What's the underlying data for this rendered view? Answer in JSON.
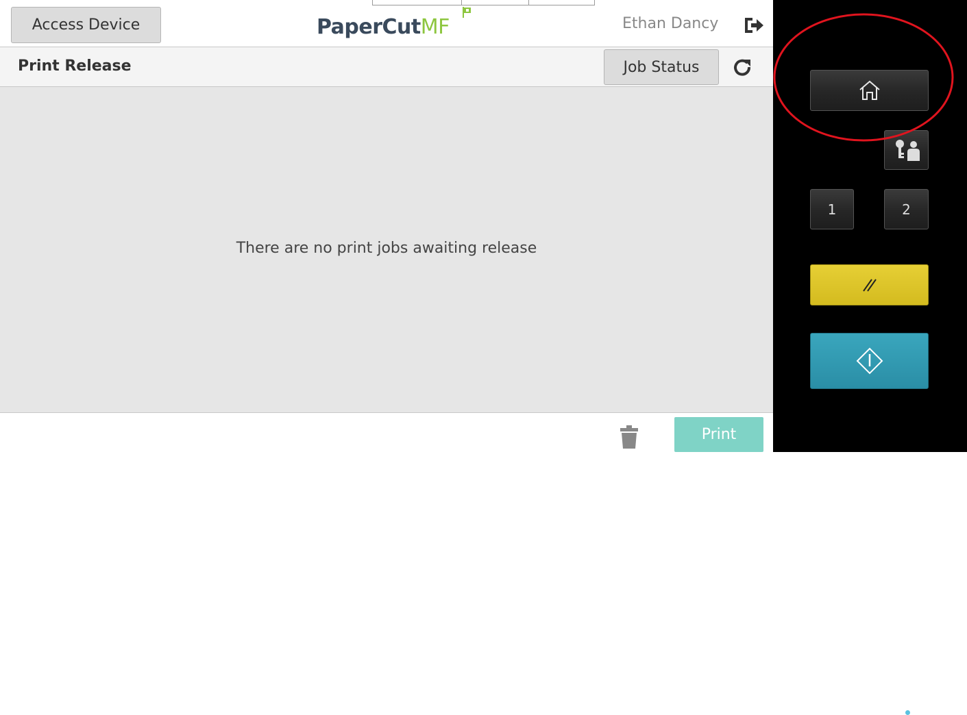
{
  "header": {
    "access_button_label": "Access Device",
    "logo_main": "PaperCut",
    "logo_suffix": "MF",
    "username": "Ethan Dancy"
  },
  "subheader": {
    "title": "Print Release",
    "job_status_label": "Job Status"
  },
  "content": {
    "empty_message": "There are no print jobs awaiting release"
  },
  "footer": {
    "print_label": "Print"
  },
  "hardware_panel": {
    "key_1_label": "1",
    "key_2_label": "2"
  },
  "colors": {
    "print_button": "#7fd3c6",
    "logo_green": "#8dc63f",
    "reset_key": "#d4bb1f",
    "start_key": "#2a8ea6",
    "annotation_circle": "#e0141e"
  },
  "icons": [
    "logout-icon",
    "refresh-icon",
    "trash-icon",
    "home-icon",
    "user-key-icon",
    "reset-icon",
    "start-icon"
  ]
}
